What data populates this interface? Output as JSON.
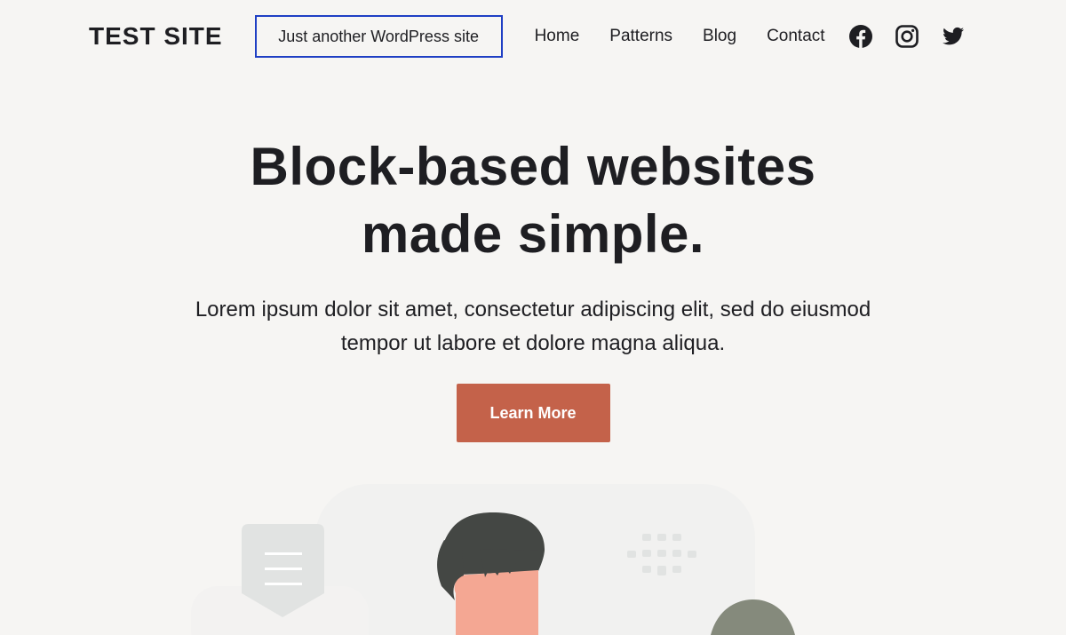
{
  "header": {
    "site_title": "TEST SITE",
    "tagline": "Just another WordPress site",
    "nav": [
      {
        "label": "Home"
      },
      {
        "label": "Patterns"
      },
      {
        "label": "Blog"
      },
      {
        "label": "Contact"
      }
    ],
    "social": [
      "facebook-icon",
      "instagram-icon",
      "twitter-icon"
    ]
  },
  "hero": {
    "heading_line1": "Block-based websites",
    "heading_line2": "made simple.",
    "description": "Lorem ipsum dolor sit amet, consectetur adipiscing elit, sed do eiusmod tempor ut labore et dolore magna aliqua.",
    "cta_label": "Learn More"
  },
  "colors": {
    "background": "#f6f5f3",
    "text": "#1e1e22",
    "accent": "#c4624a",
    "focus_outline": "#1f3fc4"
  }
}
